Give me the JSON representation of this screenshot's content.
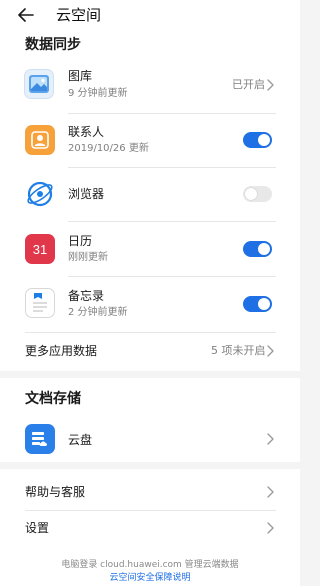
{
  "header": {
    "title": "云空间"
  },
  "data_sync": {
    "section_title": "数据同步",
    "items": [
      {
        "name": "图库",
        "subtitle": "9 分钟前更新",
        "status_text": "已开启",
        "icon": "gallery-icon"
      },
      {
        "name": "联系人",
        "subtitle": "2019/10/26 更新",
        "toggle": "on",
        "icon": "contacts-icon"
      },
      {
        "name": "浏览器",
        "toggle": "off",
        "icon": "browser-icon"
      },
      {
        "name": "日历",
        "subtitle": "刚刚更新",
        "toggle": "on",
        "icon": "calendar-icon",
        "icon_text": "31"
      },
      {
        "name": "备忘录",
        "subtitle": "2 分钟前更新",
        "toggle": "on",
        "icon": "notes-icon"
      }
    ],
    "more": {
      "label": "更多应用数据",
      "status_text": "5 项未开启"
    }
  },
  "doc_storage": {
    "section_title": "文档存储",
    "item": {
      "name": "云盘",
      "icon": "cloud-drive-icon"
    }
  },
  "other": {
    "help_label": "帮助与客服",
    "settings_label": "设置"
  },
  "footer": {
    "line1": "电脑登录 cloud.huawei.com 管理云端数据",
    "link": "云空间安全保障说明"
  },
  "colors": {
    "accent": "#1f6fe5",
    "toggle_off": "#e8e8e8",
    "background": "#f4f4f4"
  }
}
